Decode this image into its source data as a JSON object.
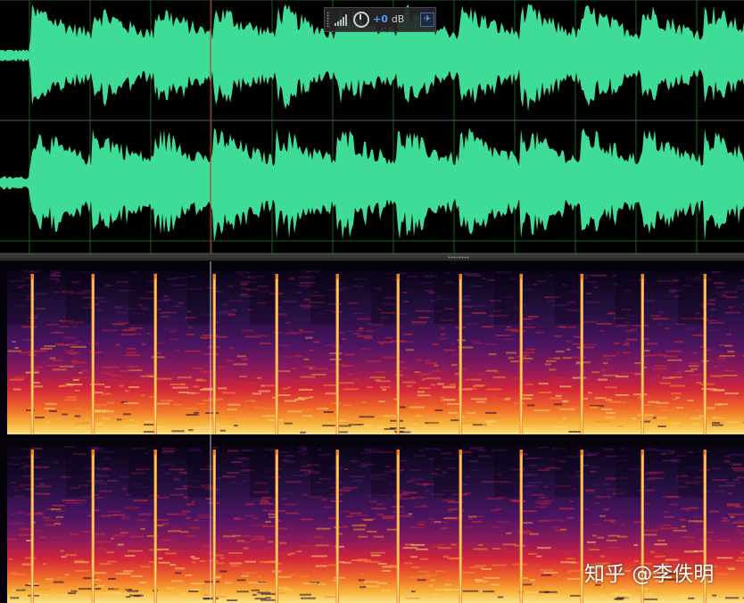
{
  "hud": {
    "gain_value": "+0",
    "gain_unit": "dB",
    "meter_icon": "signal-bars-icon",
    "knob_icon": "volume-knob-icon",
    "pin_icon": "pin-icon",
    "pin_glyph": "✈"
  },
  "watermark": {
    "text": "知乎 @李佚明"
  },
  "colors": {
    "waveform": "#3fdc98",
    "background": "#000000",
    "grid": "#1f5a1f",
    "center_line": "#5c5c5c",
    "playhead": "#c0281e",
    "spectral_cursor": "#e8e8e8",
    "gain_accent": "#4aa0ff"
  }
}
